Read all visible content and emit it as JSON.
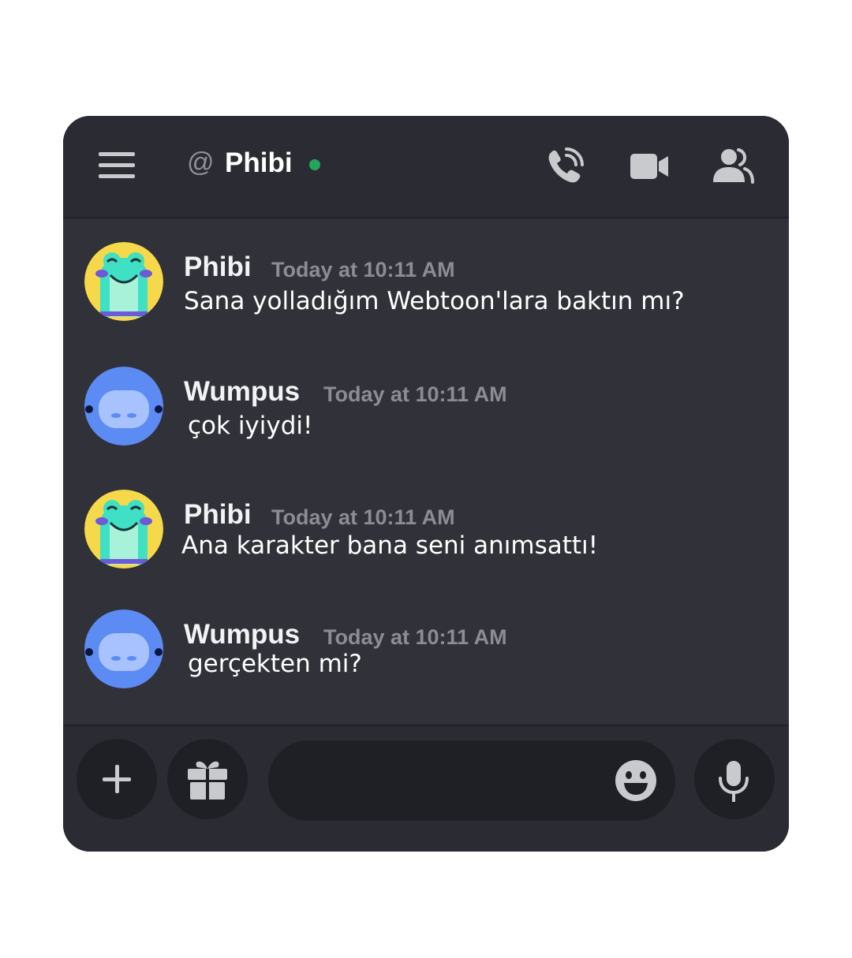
{
  "header": {
    "at_symbol": "@",
    "channel_name": "Phibi",
    "status_color": "#23a55a",
    "icons": [
      "menu-icon",
      "voice-call-icon",
      "video-call-icon",
      "member-list-icon"
    ]
  },
  "messages": [
    {
      "author": "Phibi",
      "timestamp": "Today at 10:11 AM",
      "content": "Sana yolladığım Webtoon'lara baktın mı?",
      "avatar": "frog-avatar"
    },
    {
      "author": "Wumpus",
      "timestamp": "Today at 10:11 AM",
      "content": "çok iyiydi!",
      "avatar": "wumpus-avatar"
    },
    {
      "author": "Phibi",
      "timestamp": "Today at 10:11 AM",
      "content": "Ana karakter bana seni anımsattı!",
      "avatar": "frog-avatar"
    },
    {
      "author": "Wumpus",
      "timestamp": "Today at 10:11 AM",
      "content": "gerçekten mi?",
      "avatar": "wumpus-avatar"
    }
  ],
  "composer": {
    "message_value": "",
    "icons": [
      "plus-icon",
      "gift-icon",
      "emoji-icon",
      "microphone-icon"
    ]
  },
  "colors": {
    "background": "#313139",
    "header": "#2b2c33",
    "button": "#1f2026",
    "frog": "#3fe0c3",
    "wumpus": "#5d8bf4"
  }
}
